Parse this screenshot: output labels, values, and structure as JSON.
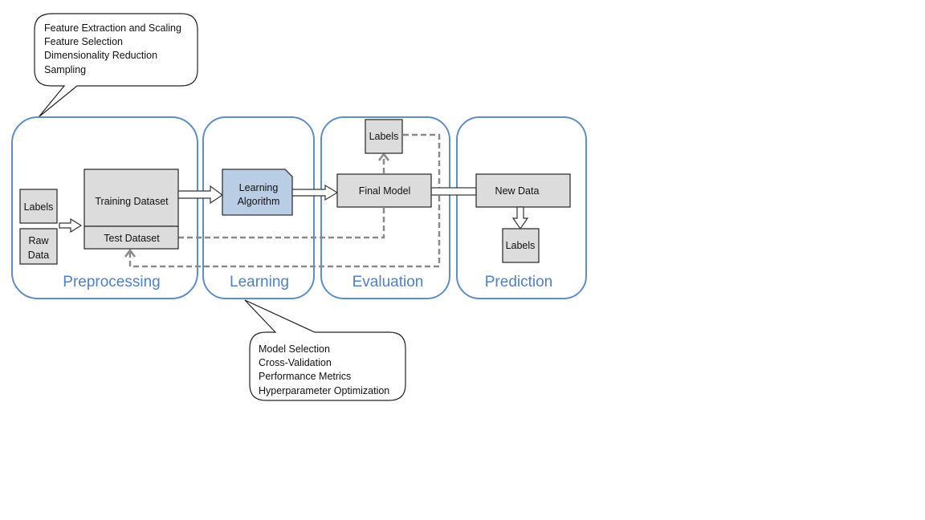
{
  "preprocessing_callout": {
    "lines": [
      "Feature Extraction and Scaling",
      "Feature Selection",
      "Dimensionality Reduction",
      "Sampling"
    ]
  },
  "learning_callout": {
    "lines": [
      "Model Selection",
      "Cross-Validation",
      "Performance Metrics",
      "Hyperparameter Optimization"
    ]
  },
  "panels": {
    "preprocessing": "Preprocessing",
    "learning": "Learning",
    "evaluation": "Evaluation",
    "prediction": "Prediction"
  },
  "nodes": {
    "labels_input": "Labels",
    "raw_data": [
      "Raw",
      "Data"
    ],
    "training_dataset": "Training Dataset",
    "test_dataset": "Test Dataset",
    "learning_algorithm": [
      "Learning",
      "Algorithm"
    ],
    "final_model": "Final Model",
    "eval_labels": "Labels",
    "new_data": "New Data",
    "predicted_labels": "Labels"
  },
  "colors": {
    "panel_border": "#5e8ec8",
    "panel_label": "#4f81c4",
    "box_fill": "#dcdcdc",
    "algorithm_fill": "#b9cde5",
    "dashed_arrow": "#8a8a8a"
  }
}
